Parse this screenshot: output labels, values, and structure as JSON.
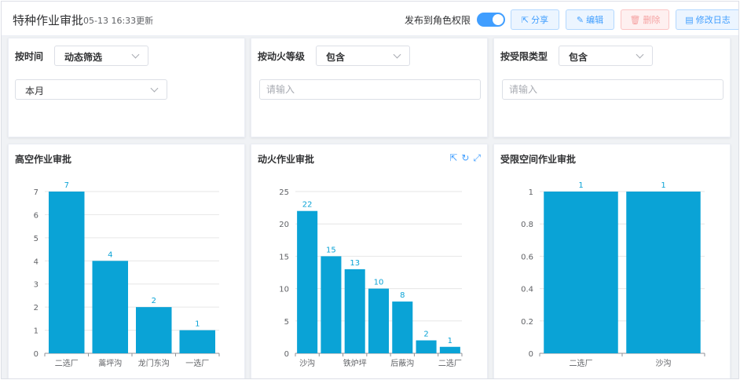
{
  "header": {
    "title": "特种作业审批",
    "updated": "05-13 16:33更新",
    "publish_label": "发布到角色权限",
    "publish_on": true,
    "buttons": {
      "share": "分享",
      "edit": "编辑",
      "delete": "删除",
      "log": "修改日志"
    }
  },
  "filters": [
    {
      "label": "按时间",
      "mode": "动态筛选",
      "value": "本月",
      "placeholder": ""
    },
    {
      "label": "按动火等级",
      "mode": "包含",
      "value": "",
      "placeholder": "请输入"
    },
    {
      "label": "按受限类型",
      "mode": "包含",
      "value": "",
      "placeholder": "请输入"
    }
  ],
  "colors": {
    "bar": "#0aa3d6",
    "label": "#0aa3d6",
    "accent": "#409eff"
  },
  "chart_data": [
    {
      "type": "bar",
      "title": "高空作业审批",
      "categories": [
        "二选厂",
        "蒿坪沟",
        "龙门东沟",
        "一选厂"
      ],
      "values": [
        7,
        4,
        2,
        1
      ],
      "ylim": [
        0,
        7
      ],
      "yticks": [
        "0",
        "1",
        "2",
        "3",
        "4",
        "5",
        "6",
        "7"
      ]
    },
    {
      "type": "bar",
      "title": "动火作业审批",
      "categories": [
        "沙沟",
        "",
        "铁炉坪",
        "",
        "后蔽沟",
        "",
        "二选厂"
      ],
      "values": [
        22,
        15,
        13,
        10,
        8,
        2,
        1
      ],
      "ylim": [
        0,
        25
      ],
      "yticks": [
        "0",
        "5",
        "10",
        "15",
        "20",
        "25"
      ]
    },
    {
      "type": "bar",
      "title": "受限空间作业审批",
      "categories": [
        "二选厂",
        "沙沟"
      ],
      "values": [
        1,
        1
      ],
      "ylim": [
        0,
        1
      ],
      "yticks": [
        "0",
        "0.2",
        "0.4",
        "0.6",
        "0.8",
        "1"
      ]
    }
  ]
}
